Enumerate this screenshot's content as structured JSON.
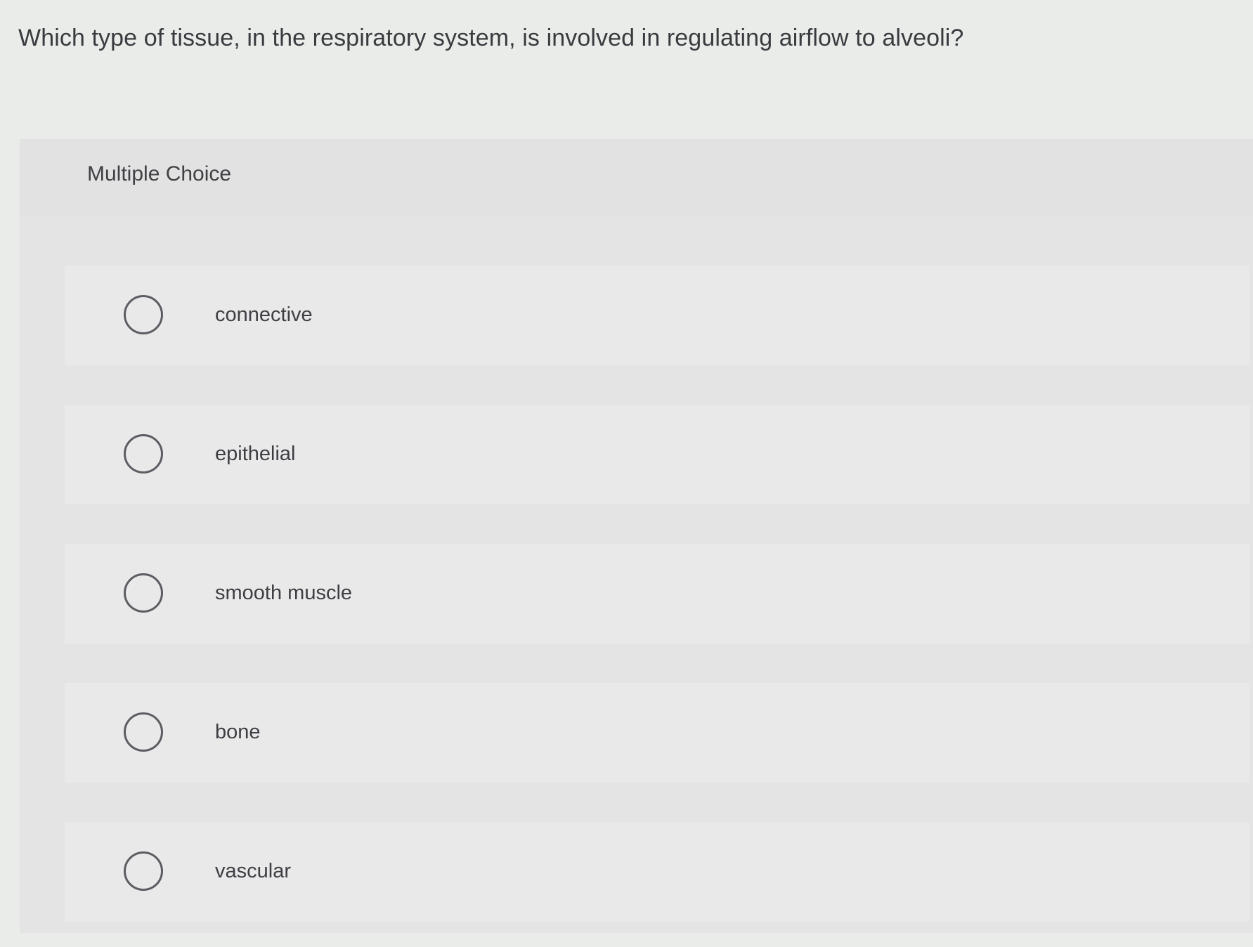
{
  "question": {
    "text": "Which type of tissue, in the respiratory system, is involved in regulating airflow to alveoli?"
  },
  "panel": {
    "title": "Multiple Choice",
    "options": [
      {
        "label": "connective",
        "selected": false
      },
      {
        "label": "epithelial",
        "selected": false
      },
      {
        "label": "smooth muscle",
        "selected": false
      },
      {
        "label": "bone",
        "selected": false
      },
      {
        "label": "vascular",
        "selected": false
      }
    ]
  },
  "icons": {
    "radio": "radio-unchecked-icon"
  }
}
